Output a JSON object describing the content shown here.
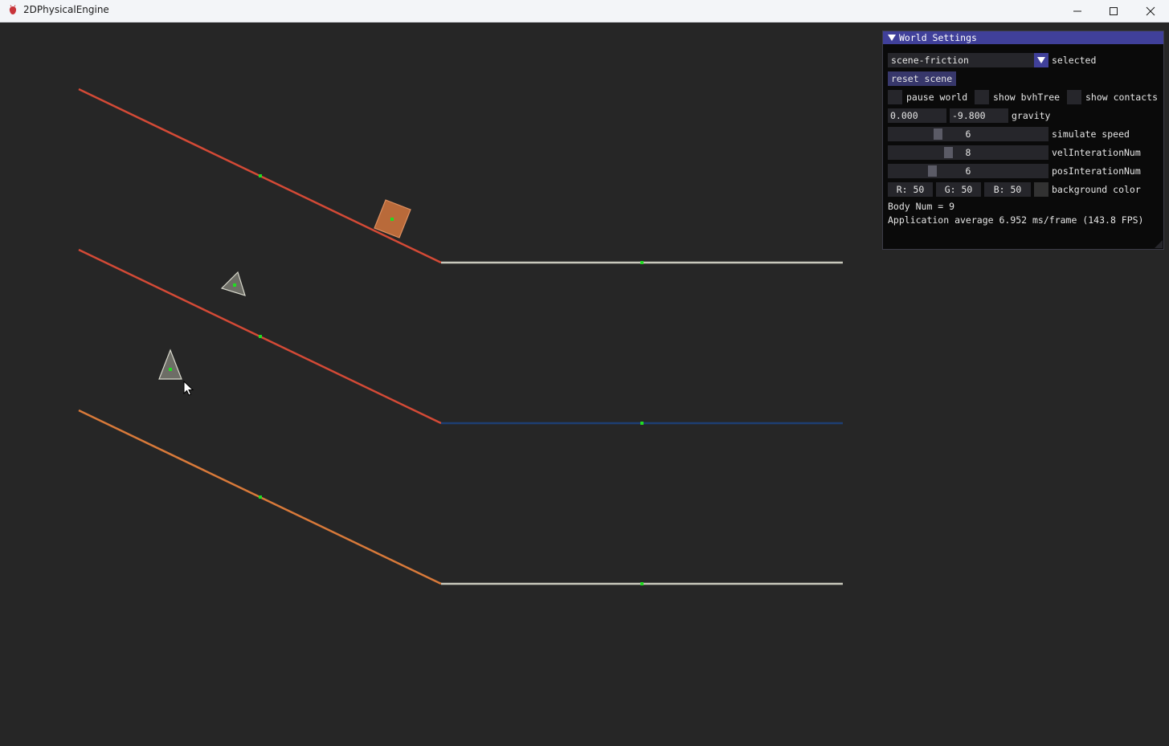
{
  "window": {
    "title": "2DPhysicalEngine",
    "controls": [
      "minimize-icon",
      "maximize-icon",
      "close-icon"
    ]
  },
  "scene": {
    "background": "#262626",
    "colors": {
      "red_slope": "#d44a36",
      "orange_slope": "#d97a3a",
      "light_floor": "#c9c9bd",
      "blue_floor": "#1d3e73",
      "center_dot": "#22dd22",
      "box_fill": "#b96a3a",
      "triangle_fill": "#6d6d66"
    }
  },
  "panel": {
    "title": "World Settings",
    "scene_select": {
      "value": "scene-friction",
      "label": "selected"
    },
    "reset_label": "reset scene",
    "checkboxes": [
      {
        "label": "pause world",
        "checked": false
      },
      {
        "label": "show bvhTree",
        "checked": false
      },
      {
        "label": "show contacts",
        "checked": false
      }
    ],
    "gravity": {
      "x": "0.000",
      "y": "-9.800",
      "label": "gravity"
    },
    "sliders": [
      {
        "value": "6",
        "label": "simulate speed"
      },
      {
        "value": "8",
        "label": "velInterationNum"
      },
      {
        "value": "6",
        "label": "posInterationNum"
      }
    ],
    "background_color": {
      "r": "R: 50",
      "g": "G: 50",
      "b": "B: 50",
      "label": "background color",
      "swatch": "#323232"
    },
    "body_num": "Body Num = 9",
    "fps_text": "Application average 6.952 ms/frame (143.8 FPS)"
  }
}
